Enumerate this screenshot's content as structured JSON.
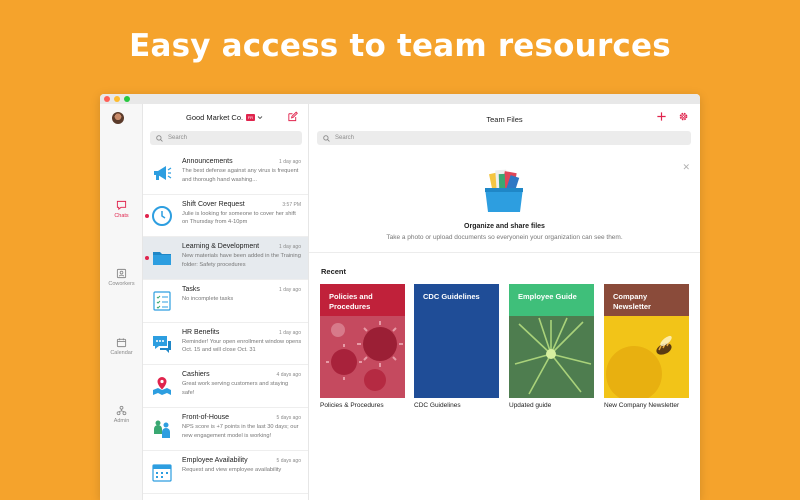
{
  "headline": "Easy access to team resources",
  "rail": {
    "chats": "Chats",
    "coworkers": "Coworkers",
    "calendar": "Calendar",
    "admin": "Admin"
  },
  "list": {
    "org_name": "Good Market Co.",
    "org_badge": "FR",
    "search_placeholder": "Search",
    "items": [
      {
        "title": "Announcements",
        "time": "1 day ago",
        "preview": "The best defense against any virus is frequent and thorough hand washing...",
        "icon": "megaphone-icon",
        "unread": false,
        "selected": false
      },
      {
        "title": "Shift Cover Request",
        "time": "3:57 PM",
        "preview": "Julie is looking for someone to cover her shift on Thursday from 4-10pm",
        "icon": "clock-icon",
        "unread": true,
        "selected": false
      },
      {
        "title": "Learning & Development",
        "time": "1 day ago",
        "preview": "New materials have been added in the Training folder: Safety procedures",
        "icon": "folder-icon",
        "unread": true,
        "selected": true
      },
      {
        "title": "Tasks",
        "time": "1 day ago",
        "preview": "No incomplete tasks",
        "icon": "checklist-icon",
        "unread": false,
        "selected": false
      },
      {
        "title": "HR Benefits",
        "time": "1 day ago",
        "preview": "Reminder! Your open enrollment window opens Oct. 15 and will close Oct. 31",
        "icon": "chat-bubbles-icon",
        "unread": false,
        "selected": false
      },
      {
        "title": "Cashiers",
        "time": "4 days ago",
        "preview": "Great work serving customers and staying safe!",
        "icon": "map-pin-icon",
        "unread": false,
        "selected": false
      },
      {
        "title": "Front-of-House",
        "time": "5 days ago",
        "preview": "NPS score is +7 points in the last 30 days; our new engagement model is working!",
        "icon": "people-icon",
        "unread": false,
        "selected": false
      },
      {
        "title": "Employee Availability",
        "time": "5 days ago",
        "preview": "Request and view employee availability",
        "icon": "calendar-icon",
        "unread": false,
        "selected": false
      }
    ]
  },
  "main": {
    "title": "Team Files",
    "search_placeholder": "Search",
    "empty_title": "Organize and share files",
    "empty_subtitle": "Take a photo or upload documents so everyonein your organization can see them.",
    "recent_label": "Recent",
    "cards": [
      {
        "title": "Policies and Procedures",
        "caption": "Policies & Procedures",
        "band": "#c0213a"
      },
      {
        "title": "CDC Guidelines",
        "caption": "CDC Guidelines",
        "band": "#1f4d97"
      },
      {
        "title": "Employee Guide",
        "caption": "Updated guide",
        "band": "#3fbf7a"
      },
      {
        "title": "Company Newsletter",
        "caption": "New Company Newsletter",
        "band": "#8a4b3a"
      }
    ]
  },
  "colors": {
    "background": "#f5a32c",
    "accent": "#e0244d"
  }
}
